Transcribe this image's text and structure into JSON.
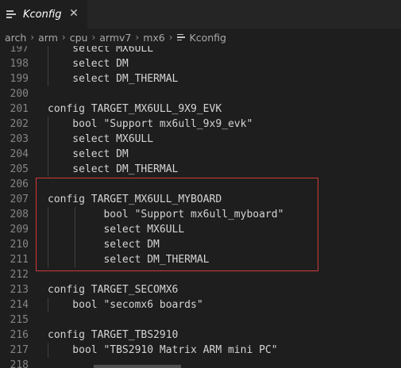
{
  "tab": {
    "title": "Kconfig",
    "icon": "lines-icon",
    "close_icon": "close-icon"
  },
  "breadcrumb": {
    "items": [
      "arch",
      "arm",
      "cpu",
      "armv7",
      "mx6",
      "Kconfig"
    ],
    "file_icon": "file-lines-icon"
  },
  "editor": {
    "lines": [
      {
        "num": "197",
        "text": "    select MX6ULL",
        "indent": 1
      },
      {
        "num": "198",
        "text": "    select DM",
        "indent": 1
      },
      {
        "num": "199",
        "text": "    select DM_THERMAL",
        "indent": 1
      },
      {
        "num": "200",
        "text": "",
        "indent": 0
      },
      {
        "num": "201",
        "text": "config TARGET_MX6ULL_9X9_EVK",
        "indent": 0
      },
      {
        "num": "202",
        "text": "    bool \"Support mx6ull_9x9_evk\"",
        "indent": 1
      },
      {
        "num": "203",
        "text": "    select MX6ULL",
        "indent": 1
      },
      {
        "num": "204",
        "text": "    select DM",
        "indent": 1
      },
      {
        "num": "205",
        "text": "    select DM_THERMAL",
        "indent": 1
      },
      {
        "num": "206",
        "text": "",
        "indent": 0
      },
      {
        "num": "207",
        "text": "config TARGET_MX6ULL_MYBOARD",
        "indent": 0
      },
      {
        "num": "208",
        "text": "         bool \"Support mx6ull_myboard\"",
        "indent": 2
      },
      {
        "num": "209",
        "text": "         select MX6ULL",
        "indent": 2
      },
      {
        "num": "210",
        "text": "         select DM",
        "indent": 2
      },
      {
        "num": "211",
        "text": "         select DM_THERMAL",
        "indent": 2
      },
      {
        "num": "212",
        "text": "",
        "indent": 0
      },
      {
        "num": "213",
        "text": "config TARGET_SECOMX6",
        "indent": 0
      },
      {
        "num": "214",
        "text": "    bool \"secomx6 boards\"",
        "indent": 1
      },
      {
        "num": "215",
        "text": "",
        "indent": 0
      },
      {
        "num": "216",
        "text": "config TARGET_TBS2910",
        "indent": 0
      },
      {
        "num": "217",
        "text": "    bool \"TBS2910 Matrix ARM mini PC\"",
        "indent": 1
      },
      {
        "num": "218",
        "text": "",
        "indent": 0
      }
    ]
  },
  "colors": {
    "background": "#1e1e1e",
    "highlight_border": "#d23a3a",
    "line_number": "#858585",
    "code_text": "#d4d4d4"
  }
}
